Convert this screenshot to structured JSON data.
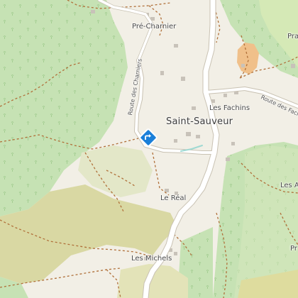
{
  "map": {
    "labels": {
      "pre_charnier": "Pré-Charnier",
      "saint_sauveur": "Saint-Sauveur",
      "les_fachins": "Les Fachins",
      "le_real": "Le Réal",
      "les_michels": "Les Michels",
      "route_des_charniers": "Route des Charniers",
      "route_des_fachins": "Route des Fachins",
      "edge_pra": "Pra",
      "edge_les_a": "Les A",
      "edge_pr": "Pr"
    },
    "marker_icon": "directions-diamond-icon",
    "colors": {
      "forest": "#c6e2b4",
      "meadow": "#dfe4c5",
      "field": "#d9d8a3",
      "background": "#f2efe6",
      "road": "#ffffff",
      "road_casing": "#c9c2b3",
      "trail": "#b0703a",
      "marker": "#1a7fd9"
    }
  }
}
